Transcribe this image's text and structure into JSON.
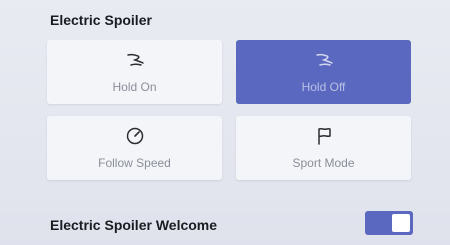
{
  "spoiler": {
    "title": "Electric Spoiler",
    "modes": [
      {
        "label": "Hold On",
        "icon": "spoiler-hold-on-icon",
        "selected": false
      },
      {
        "label": "Hold Off",
        "icon": "spoiler-hold-off-icon",
        "selected": true
      },
      {
        "label": "Follow Speed",
        "icon": "speedometer-icon",
        "selected": false
      },
      {
        "label": "Sport Mode",
        "icon": "flag-icon",
        "selected": false
      }
    ]
  },
  "welcome": {
    "label": "Electric Spoiler Welcome",
    "enabled": true
  },
  "colors": {
    "accent": "#5a69bf",
    "tile": "#f4f5f9",
    "background": "#e6e8f0"
  }
}
